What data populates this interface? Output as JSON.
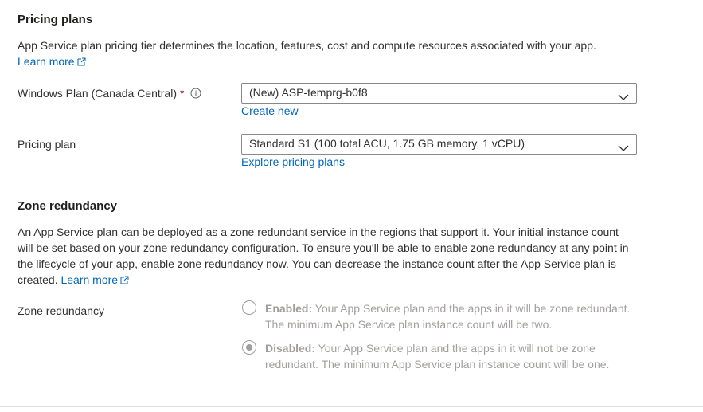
{
  "pricing_plans": {
    "title": "Pricing plans",
    "description": "App Service plan pricing tier determines the location, features, cost and compute resources associated with your app.",
    "learn_more": "Learn more"
  },
  "windows_plan": {
    "label": "Windows Plan (Canada Central)",
    "required_mark": "*",
    "value": "(New) ASP-temprg-b0f8",
    "create_new": "Create new"
  },
  "pricing_plan": {
    "label": "Pricing plan",
    "value": "Standard S1 (100 total ACU, 1.75 GB memory, 1 vCPU)",
    "explore": "Explore pricing plans"
  },
  "zone_redundancy": {
    "title": "Zone redundancy",
    "description": "An App Service plan can be deployed as a zone redundant service in the regions that support it. Your initial instance count will be set based on your zone redundancy configuration. To ensure you'll be able to enable zone redundancy at any point in the lifecycle of your app, enable zone redundancy now. You can decrease the instance count after the App Service plan is created.",
    "learn_more": "Learn more",
    "field_label": "Zone redundancy",
    "options": [
      {
        "title": "Enabled:",
        "text": "Your App Service plan and the apps in it will be zone redundant. The minimum App Service plan instance count will be two.",
        "selected": false
      },
      {
        "title": "Disabled:",
        "text": "Your App Service plan and the apps in it will not be zone redundant. The minimum App Service plan instance count will be one.",
        "selected": true
      }
    ]
  },
  "colors": {
    "link": "#0066b8",
    "required": "#a4262c",
    "disabled_text": "#a19f9d",
    "border": "#8a8886"
  }
}
